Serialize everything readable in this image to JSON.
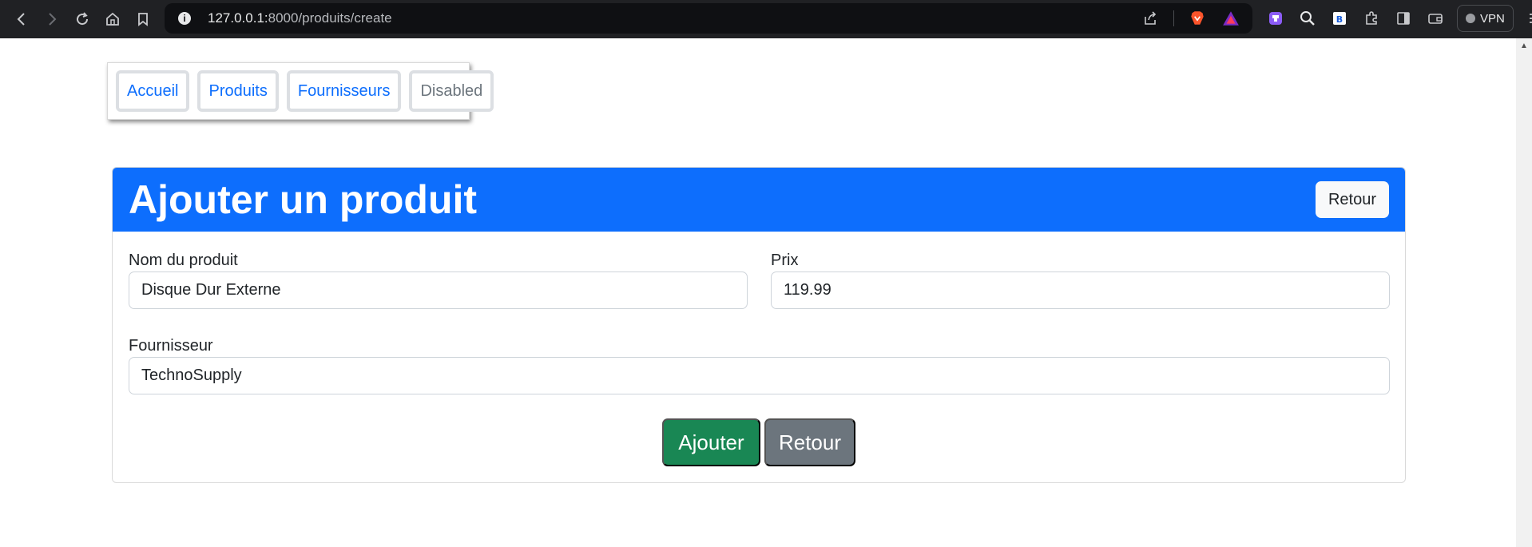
{
  "browser": {
    "url_host": "127.0.0.1:",
    "url_path": "8000/produits/create",
    "vpn_label": "VPN",
    "icons": [
      "back-icon",
      "forward-icon",
      "reload-icon",
      "home-icon",
      "bookmark-icon",
      "info-icon",
      "share-icon",
      "brave-icon",
      "rewards-icon",
      "extension-purple-icon",
      "search-ext-icon",
      "bitwarden-icon",
      "puzzle-icon",
      "sidebar-icon",
      "wallet-icon",
      "menu-icon"
    ]
  },
  "nav": {
    "items": [
      {
        "label": "Accueil"
      },
      {
        "label": "Produits"
      },
      {
        "label": "Fournisseurs"
      },
      {
        "label": "Disabled"
      }
    ]
  },
  "card": {
    "title": "Ajouter un produit",
    "back_label": "Retour"
  },
  "form": {
    "name_label": "Nom du produit",
    "name_value": "Disque Dur Externe",
    "price_label": "Prix",
    "price_value": "119.99",
    "supplier_label": "Fournisseur",
    "supplier_value": "TechnoSupply",
    "submit_label": "Ajouter",
    "back_label": "Retour"
  },
  "colors": {
    "primary": "#0d6efd",
    "success": "#198754",
    "secondary": "#6c757d",
    "chrome": "#202124"
  }
}
